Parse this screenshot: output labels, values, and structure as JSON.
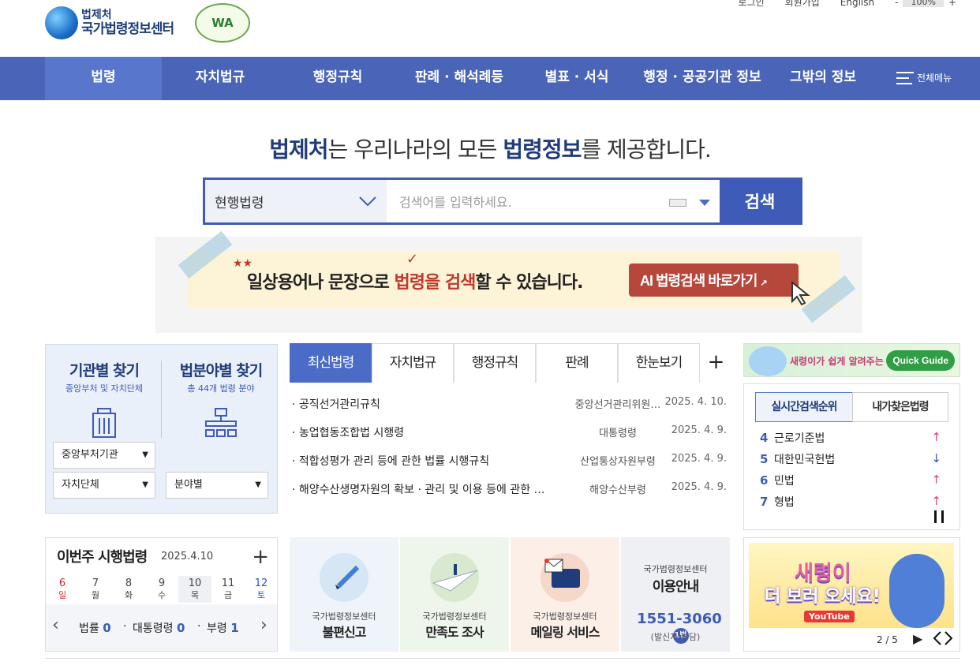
{
  "util": {
    "login": "로그인",
    "join": "회원가입",
    "english": "English",
    "zoom_minus": "-",
    "zoom": "100%",
    "zoom_plus": "+"
  },
  "logo": {
    "line1": "법제처",
    "line2": "국가법령정보센터",
    "badge": "WA"
  },
  "nav": {
    "items": [
      "법령",
      "자치법규",
      "행정규칙",
      "판례 · 해석례등",
      "별표 · 서식",
      "행정 · 공공기관 정보",
      "그밖의 정보"
    ],
    "all_menu": "전체메뉴"
  },
  "hero": {
    "part1": "법제처",
    "part2": "는 우리나라의 모든 ",
    "part3": "법령정보",
    "part4": "를 제공합니다."
  },
  "search": {
    "select": "현행법령",
    "placeholder": "검색어를 입력하세요.",
    "button": "검색"
  },
  "banner": {
    "text1": "일상용어나 문장으로 ",
    "text2": "법령을 검색",
    "text3": "할 수 있습니다.",
    "button": "AI 법령검색 바로가기"
  },
  "finder": {
    "agency_title": "기관별 찾기",
    "agency_sub": "중앙부처 및 자치단체",
    "field_title": "법분야별 찾기",
    "field_sub": "총 44개 법령 분야",
    "dd_central": "중앙부처기관",
    "dd_local": "자치단체",
    "dd_field": "분야별"
  },
  "tabs": {
    "items": [
      "최신법령",
      "자치법규",
      "행정규칙",
      "판례",
      "한눈보기"
    ],
    "plus": "+"
  },
  "laws": [
    {
      "title": "· 공직선거관리규칙",
      "org": "중앙선거관리위원…",
      "date": "2025. 4. 10."
    },
    {
      "title": "· 농업협동조합법 시행령",
      "org": "대통령령",
      "date": "2025. 4. 9."
    },
    {
      "title": "· 적합성평가 관리 등에 관한 법률 시행규칙",
      "org": "산업통상자원부령",
      "date": "2025. 4. 9."
    },
    {
      "title": "· 해양수산생명자원의 확보 · 관리 및 이용 등에 관한 …",
      "org": "해양수산부령",
      "date": "2025. 4. 9."
    }
  ],
  "quick_guide": {
    "text": "새령이가 쉽게 알려주는 국법",
    "button": "Quick Guide"
  },
  "ranking": {
    "tab1": "실시간검색순위",
    "tab2": "내가찾은법령",
    "items": [
      {
        "n": "4",
        "name": "근로기준법",
        "dir": "↑"
      },
      {
        "n": "5",
        "name": "대한민국헌법",
        "dir": "↓"
      },
      {
        "n": "6",
        "name": "민법",
        "dir": "↑"
      },
      {
        "n": "7",
        "name": "형법",
        "dir": "↑"
      }
    ],
    "colors": {
      "up": "#e0457b",
      "down": "#2a55c9"
    }
  },
  "week": {
    "title": "이번주 시행법령",
    "date": "2025.4.10",
    "plus": "+",
    "days": [
      {
        "d": "6",
        "w": "일"
      },
      {
        "d": "7",
        "w": "월"
      },
      {
        "d": "8",
        "w": "화"
      },
      {
        "d": "9",
        "w": "수"
      },
      {
        "d": "10",
        "w": "목"
      },
      {
        "d": "11",
        "w": "금"
      },
      {
        "d": "12",
        "w": "토"
      }
    ],
    "law_label": "법률",
    "law_count": "0",
    "pres_label": "대통령령",
    "pres_count": "0",
    "min_label": "부령",
    "min_count": "1"
  },
  "services": [
    {
      "top": "국가법령정보센터",
      "name": "불편신고"
    },
    {
      "top": "국가법령정보센터",
      "name": "만족도 조사"
    },
    {
      "top": "국가법령정보센터",
      "name": "메일링 서비스"
    }
  ],
  "info": {
    "top": "국가법령정보센터",
    "name": "이용안내",
    "phone": "1551-3060",
    "badge": "1번",
    "fee": "(발신자 부담)"
  },
  "youtube": {
    "line1": "새령이",
    "line2": "더 보러 오세요!",
    "logo": "YouTube",
    "page": "2 / 5"
  }
}
